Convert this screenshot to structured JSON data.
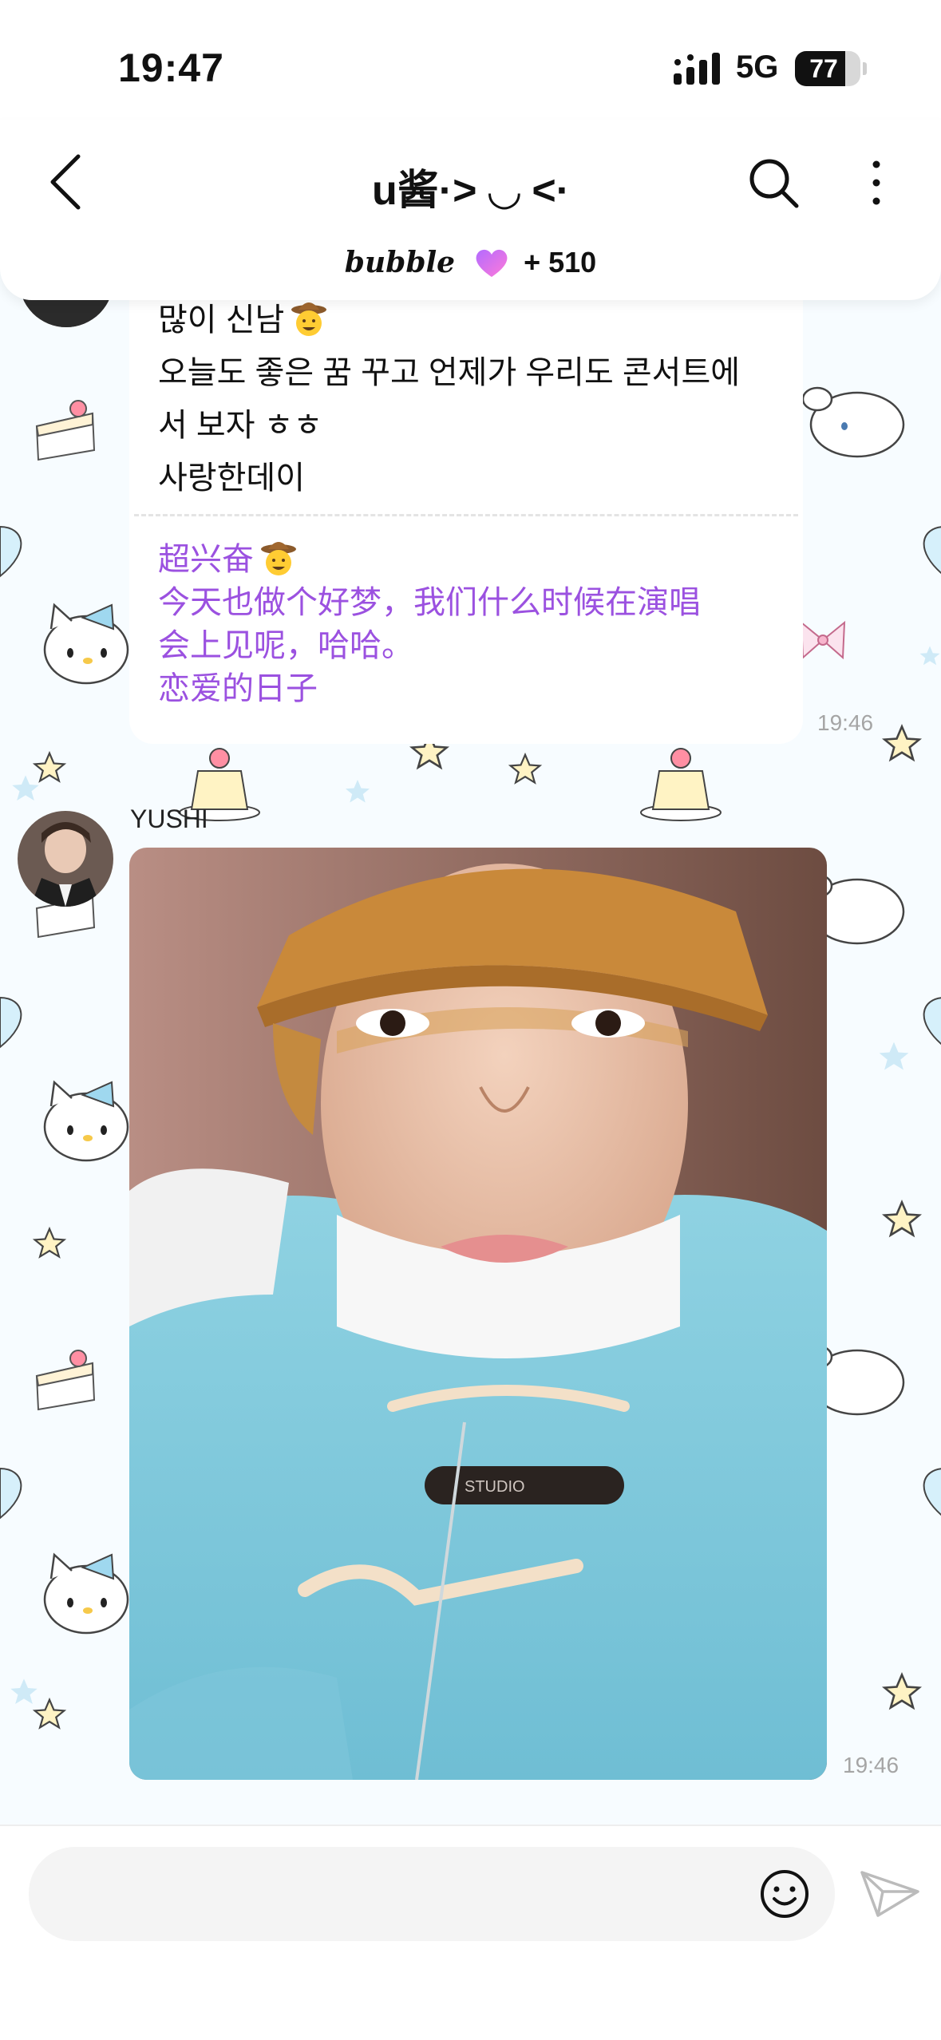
{
  "status_bar": {
    "time": "19:47",
    "network": "5G",
    "battery": "77",
    "battery_level": 0.77
  },
  "header": {
    "title": "u酱·> ◡ <·",
    "bubble_brand": "bubble",
    "bubble_count": "+ 510"
  },
  "messages": [
    {
      "type": "text",
      "lines_ko": [
        "많이 신남",
        "오늘도 좋은 꿈 꾸고 언제가 우리도 콘서트에",
        "서 보자 ㅎㅎ",
        "사랑한데이"
      ],
      "lines_zh": [
        "超兴奋",
        "今天也做个好梦，我们什么时候在演唱",
        "会上见呢，哈哈。",
        "恋爱的日子"
      ],
      "time": "19:46"
    },
    {
      "type": "photo",
      "sender": "YUSHI",
      "time": "19:46",
      "photo_text": "STUDIO"
    }
  ],
  "input": {
    "placeholder": ""
  },
  "icons": {
    "back": "chevron-left-icon",
    "search": "search-icon",
    "more": "more-vertical-icon",
    "emoji": "smiley-icon",
    "send": "send-icon",
    "heart": "heart-icon",
    "cowboy_emoji": "cowboy-emoji-icon"
  },
  "colors": {
    "translation_text": "#9b51e0",
    "heart_gradient_start": "#b36bff",
    "heart_gradient_end": "#ff7ad9",
    "wallpaper": "#f7fcff"
  }
}
